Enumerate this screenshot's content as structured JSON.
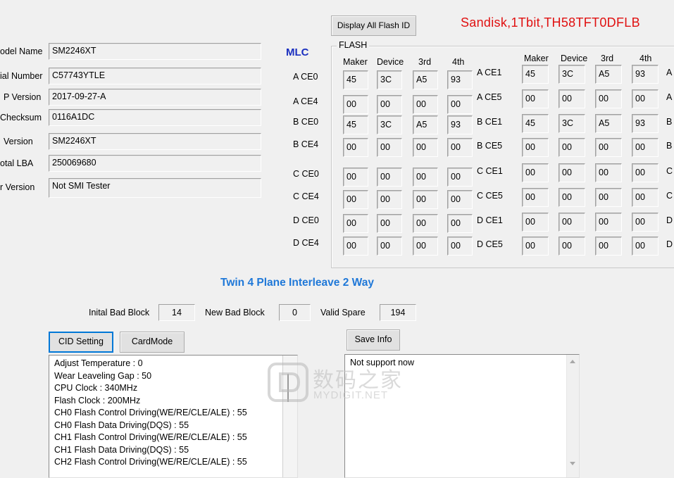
{
  "info": {
    "labels": [
      "odel Name",
      "ial Number",
      "P Version",
      "Checksum",
      "Version",
      "otal LBA",
      "r Version"
    ],
    "values": [
      "SM2246XT",
      "C57743YTLE",
      "2017-09-27-A",
      "0116A1DC",
      "SM2246XT",
      "250069680",
      "Not SMI Tester"
    ]
  },
  "mlc_label": "MLC",
  "display_all_button": "Display All Flash ID",
  "flash_title": "Sandisk,1Tbit,TH58TFT0DFLB",
  "flash_group_title": "FLASH",
  "columns": [
    "Maker",
    "Device",
    "3rd",
    "4th"
  ],
  "left_ce": {
    "labels": [
      "A CE0",
      "A CE4",
      "B CE0",
      "B CE4",
      "C CE0",
      "C CE4",
      "D CE0",
      "D CE4"
    ],
    "rows": [
      [
        "45",
        "3C",
        "A5",
        "93"
      ],
      [
        "00",
        "00",
        "00",
        "00"
      ],
      [
        "45",
        "3C",
        "A5",
        "93"
      ],
      [
        "00",
        "00",
        "00",
        "00"
      ],
      [
        "00",
        "00",
        "00",
        "00"
      ],
      [
        "00",
        "00",
        "00",
        "00"
      ],
      [
        "00",
        "00",
        "00",
        "00"
      ],
      [
        "00",
        "00",
        "00",
        "00"
      ]
    ]
  },
  "right_ce": {
    "labels": [
      "A CE1",
      "A CE5",
      "B CE1",
      "B CE5",
      "C CE1",
      "C CE5",
      "D CE1",
      "D CE5"
    ],
    "rows": [
      [
        "45",
        "3C",
        "A5",
        "93"
      ],
      [
        "00",
        "00",
        "00",
        "00"
      ],
      [
        "45",
        "3C",
        "A5",
        "93"
      ],
      [
        "00",
        "00",
        "00",
        "00"
      ],
      [
        "00",
        "00",
        "00",
        "00"
      ],
      [
        "00",
        "00",
        "00",
        "00"
      ],
      [
        "00",
        "00",
        "00",
        "00"
      ],
      [
        "00",
        "00",
        "00",
        "00"
      ]
    ],
    "edge_labels": [
      "A",
      "A",
      "B",
      "B",
      "C C",
      "C C",
      "D",
      "D"
    ]
  },
  "mode_text": "Twin 4 Plane Interleave 2 Way",
  "bad_block": {
    "initial_label": "Inital Bad Block",
    "initial_value": "14",
    "new_label": "New Bad Block",
    "new_value": "0",
    "spare_label": "Valid Spare",
    "spare_value": "194"
  },
  "buttons": {
    "cid_setting": "CID Setting",
    "card_mode": "CardMode",
    "save_info": "Save Info"
  },
  "log_lines": [
    "Adjust Temperature : 0",
    "Wear Leaveling Gap : 50",
    "CPU Clock : 340MHz",
    "Flash Clock : 200MHz",
    "CH0 Flash Control Driving(WE/RE/CLE/ALE) : 55",
    "CH0 Flash Data Driving(DQS) : 55",
    "CH1 Flash Control Driving(WE/RE/CLE/ALE) : 55",
    "CH1 Flash Data Driving(DQS) : 55",
    "CH2 Flash Control Driving(WE/RE/CLE/ALE) : 55"
  ],
  "info_text": "Not support now",
  "watermark": {
    "cn": "数码之家",
    "en": "MYDIGIT.NET"
  },
  "colors": {
    "mlc": "#1a2fbf",
    "title_red": "#e01010",
    "mode_blue": "#1f78d8"
  }
}
